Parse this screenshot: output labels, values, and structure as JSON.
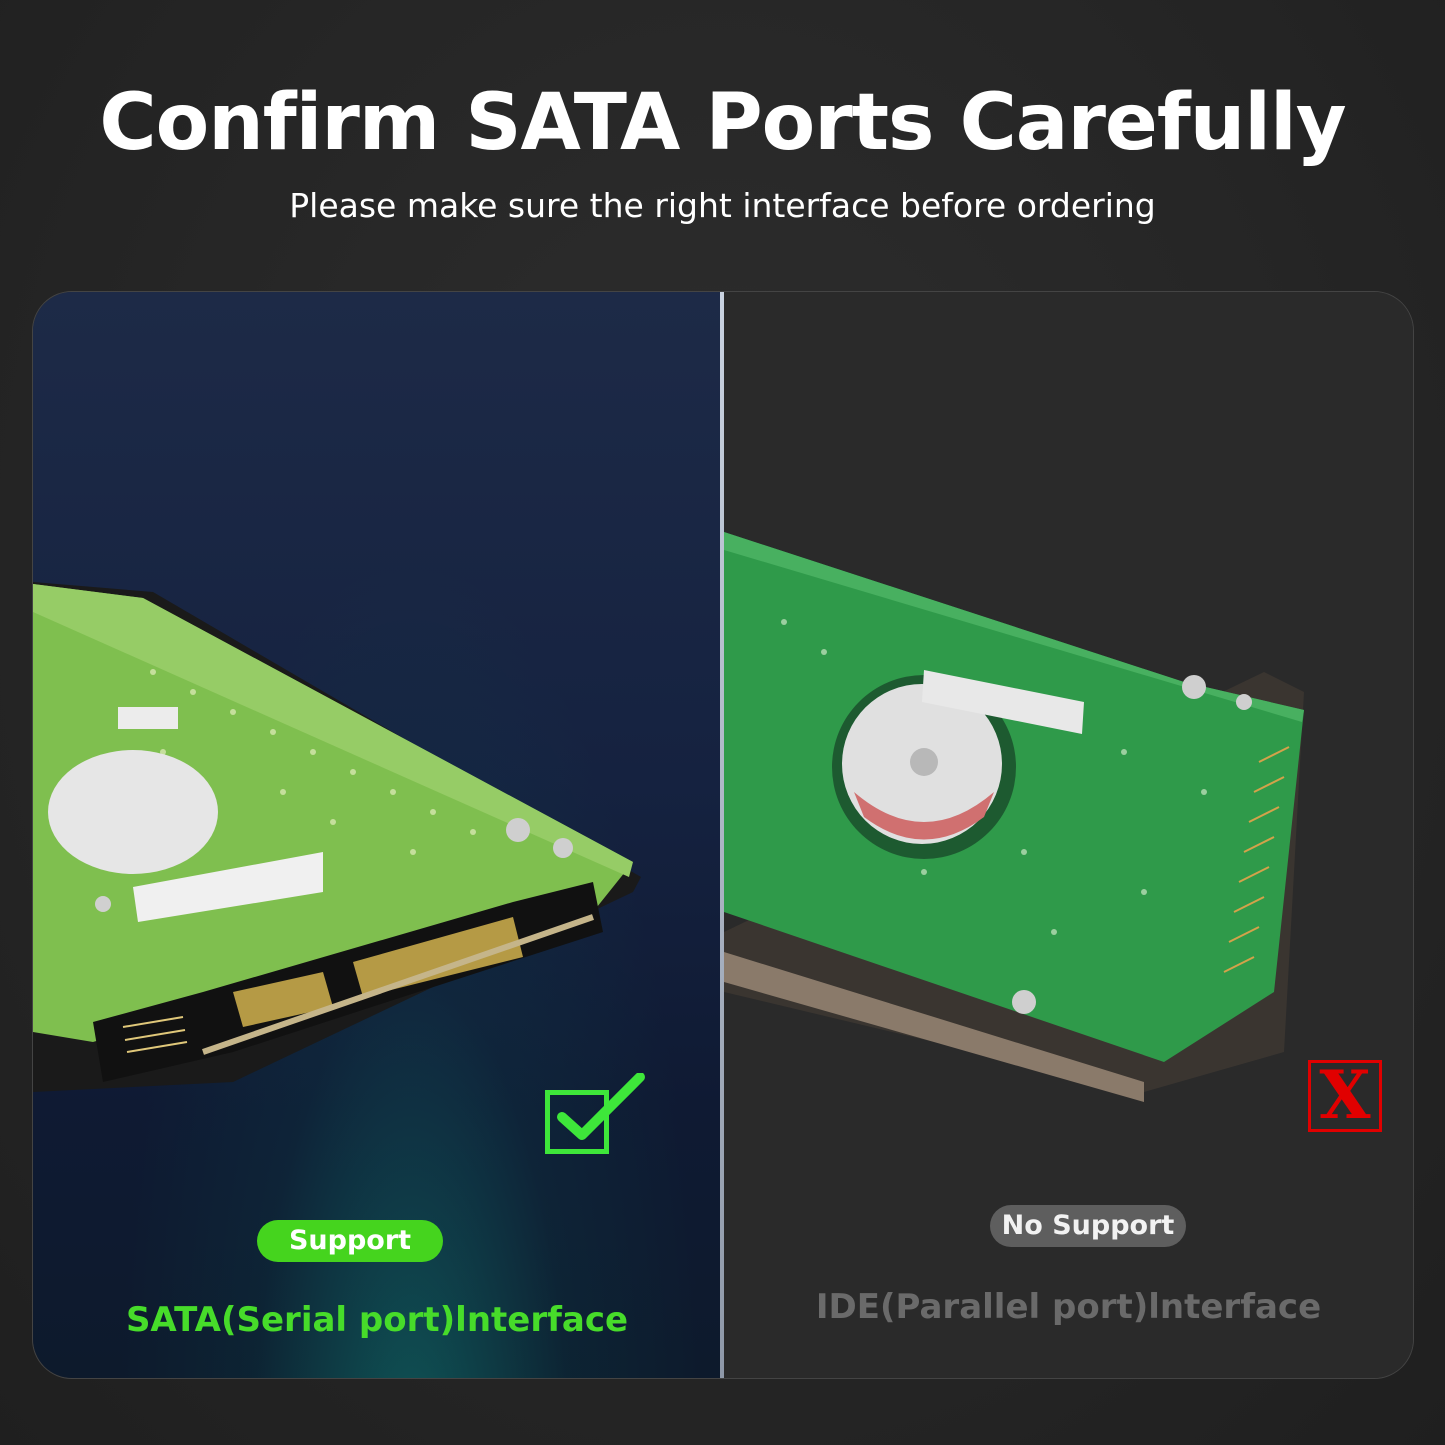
{
  "header": {
    "title": "Confirm SATA Ports Carefully",
    "subtitle": "Please make sure the right interface before ordering"
  },
  "left_panel": {
    "badge_label": "Support",
    "interface_label": "SATA(Serial port)lnterface",
    "status_icon": "check-icon",
    "accent_color": "#45d41e"
  },
  "right_panel": {
    "badge_label": "No Support",
    "interface_label": "IDE(Parallel port)lnterface",
    "status_icon": "x-icon",
    "status_text": "X",
    "accent_color": "#e10000"
  }
}
